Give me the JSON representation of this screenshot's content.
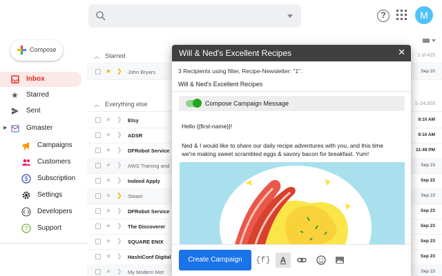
{
  "header": {
    "search_placeholder": "",
    "help_label": "?",
    "avatar_initial": "M"
  },
  "sidebar": {
    "compose_label": "Compose",
    "items": [
      {
        "label": "Inbox",
        "icon": "inbox-icon",
        "active": true
      },
      {
        "label": "Starred",
        "icon": "star-icon"
      },
      {
        "label": "Sent",
        "icon": "send-icon"
      },
      {
        "label": "Gmaster",
        "icon": "gmaster-icon"
      }
    ],
    "subitems": [
      {
        "label": "Campaigns",
        "icon": "megaphone-icon"
      },
      {
        "label": "Customers",
        "icon": "people-icon"
      },
      {
        "label": "Subscription",
        "icon": "dollar-icon"
      },
      {
        "label": "Settings",
        "icon": "gear-icon"
      },
      {
        "label": "Developers",
        "icon": "code-icon"
      },
      {
        "label": "Support",
        "icon": "help-icon"
      }
    ]
  },
  "mail": {
    "starred_header": "Starred",
    "starred_count": "1 of 425",
    "everything_header": "Everything else",
    "everything_count": "1–24,003",
    "starred_rows": [
      {
        "sender": "John Bryars",
        "date": "Sep 20",
        "starred": true,
        "important": true,
        "unread": false
      }
    ],
    "rows": [
      {
        "sender": "Etsy",
        "date": "9:10 AM",
        "starred": false,
        "important": false,
        "unread": true
      },
      {
        "sender": "ADSR",
        "date": "9:10 AM",
        "starred": false,
        "important": false,
        "unread": true
      },
      {
        "sender": "DFRobot Service",
        "date": "11:49 PM",
        "starred": false,
        "important": false,
        "unread": true
      },
      {
        "sender": "AWS Training and",
        "date": "Sep 23",
        "starred": false,
        "important": false,
        "unread": false
      },
      {
        "sender": "Indeed Apply",
        "date": "Sep 23",
        "starred": false,
        "important": false,
        "unread": true
      },
      {
        "sender": "Steam",
        "date": "Sep 23",
        "starred": false,
        "important": true,
        "unread": false
      },
      {
        "sender": "DFRobot Service",
        "date": "Sep 23",
        "starred": false,
        "important": false,
        "unread": true
      },
      {
        "sender": "The Discoverer",
        "date": "Sep 23",
        "starred": false,
        "important": false,
        "unread": true
      },
      {
        "sender": "SQUARE ENIX",
        "date": "Sep 23",
        "starred": false,
        "important": false,
        "unread": true
      },
      {
        "sender": "HashiConf Digital",
        "date": "Sep 23",
        "starred": false,
        "important": false,
        "unread": true
      },
      {
        "sender": "My Modern Met",
        "date": "Sep 23",
        "starred": false,
        "important": false,
        "unread": false
      }
    ]
  },
  "dialog": {
    "title": "Will & Ned's Excellent Recipes",
    "close_label": "✕",
    "recipient_count": "3",
    "recipients_text": "Recipients using filter, Recipe-Newsletter: \"1\".",
    "subject": "Will & Ned's Excellent Recipes",
    "mode_label": "Compose Campaign Message",
    "greeting": "Hello {{first-name}}!",
    "body_line1": "Ned & I would like to share our daily recipe adventures with you, and this time",
    "body_line2": "we're making sweet scrambled eggs & savory bacon for breakfast. Yum!",
    "create_button": "Create Campaign",
    "tool_merge": "{f}",
    "tool_text": "A"
  },
  "colors": {
    "accent_blue": "#1a73e8",
    "inbox_red": "#d93025",
    "toggle_green": "#22a622",
    "avatar": "#4fc3f7",
    "title_bar": "#404040",
    "hero_bg": "#a9e0ee"
  }
}
